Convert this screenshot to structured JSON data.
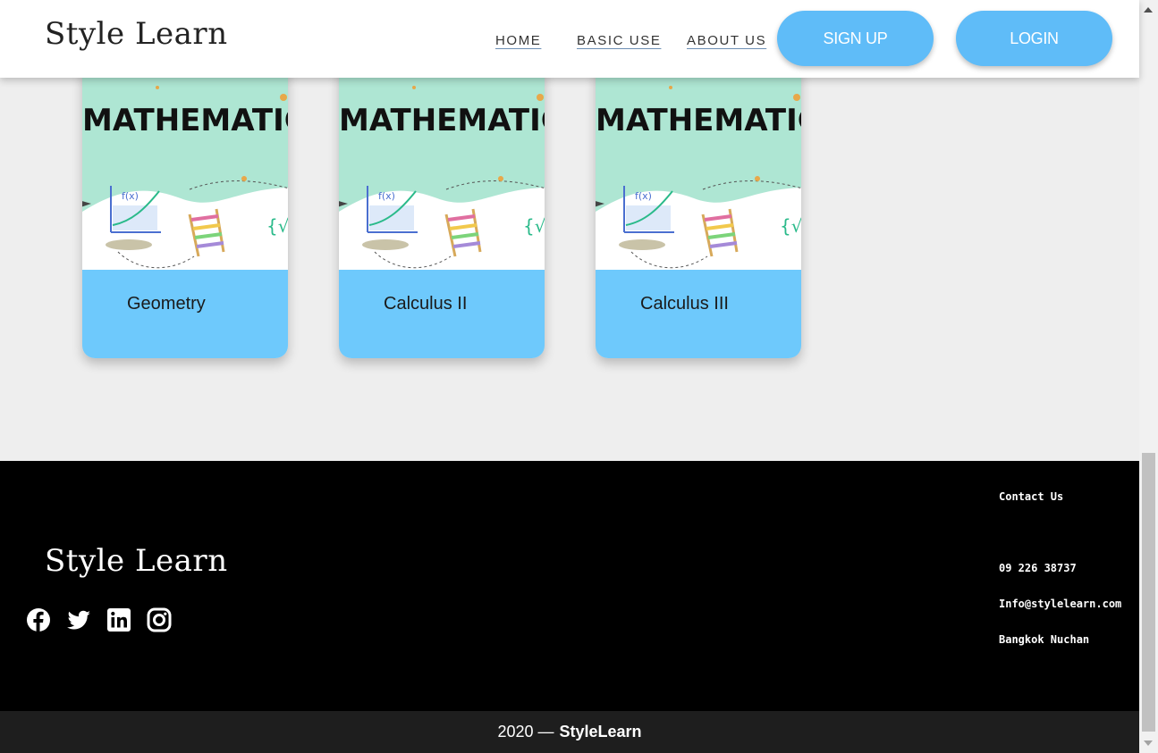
{
  "header": {
    "logo": "Style Learn",
    "nav": [
      {
        "label": "HOME"
      },
      {
        "label": "BASIC USE"
      },
      {
        "label": "ABOUT US"
      }
    ],
    "signup_label": "SIGN UP",
    "login_label": "LOGIN"
  },
  "cards": [
    {
      "image_text": "MATHEMATIC",
      "title": "Geometry"
    },
    {
      "image_text": "MATHEMATIC",
      "title": "Calculus II"
    },
    {
      "image_text": "MATHEMATIC",
      "title": "Calculus III"
    }
  ],
  "footer": {
    "logo": "Style Learn",
    "social_icons": [
      "facebook-icon",
      "twitter-icon",
      "linkedin-icon",
      "instagram-icon"
    ],
    "contact_title": "Contact Us",
    "phone": "09 226 38737",
    "email": "Info@stylelearn.com",
    "location": "Bangkok Nuchan",
    "copyright_year": "2020 —",
    "copyright_brand": "StyleLearn"
  },
  "colors": {
    "accent": "#5fbcf8",
    "card_footer": "#6ec9fc",
    "card_image_bg": "#aee6d3",
    "page_bg": "#eeeeee"
  }
}
